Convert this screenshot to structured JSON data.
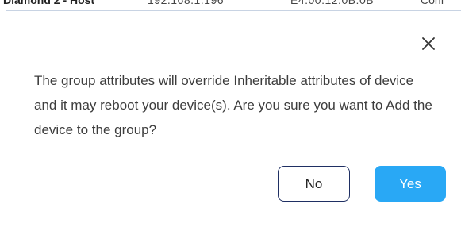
{
  "background_row": {
    "name": "Diamond 2 - Host",
    "ip": "192.168.1.196",
    "mac": "E4:00:12:0B:0B",
    "status": "Conf"
  },
  "dialog": {
    "close_icon": "close-icon",
    "message": "The group attributes will override Inheritable attributes of device and it may reboot your device(s). Are you sure you want to Add the device to the group?",
    "no_label": "No",
    "yes_label": "Yes"
  },
  "colors": {
    "primary": "#29a8f5",
    "secondary_border": "#1f2f63",
    "text": "#3d3d3d"
  }
}
